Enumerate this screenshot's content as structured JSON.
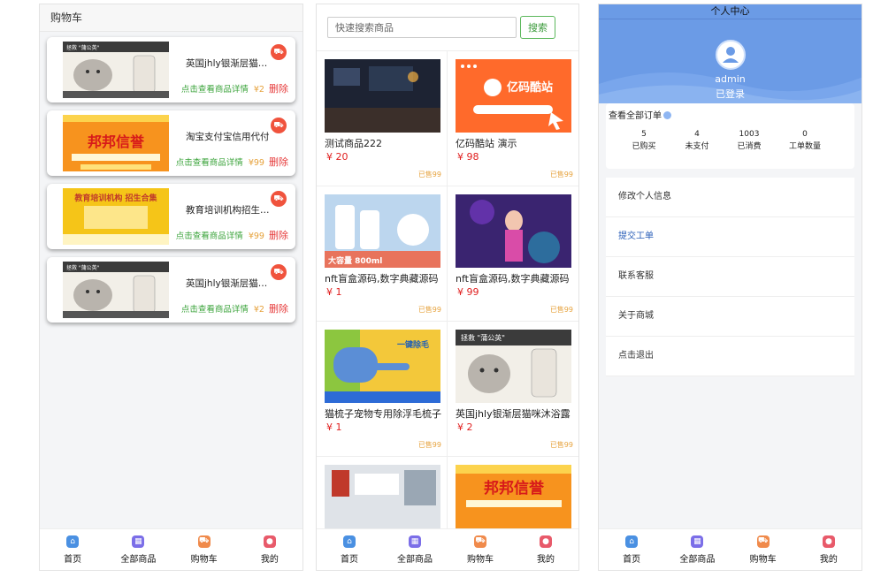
{
  "cart": {
    "title": "购物车",
    "items": [
      {
        "name": "英国jhly银渐层猫咪沐浴露",
        "detail": "点击查看商品详情",
        "price": "¥2",
        "delete": "删除",
        "image": "cat-shampoo",
        "img_text": "拯救 \"蒲公英\""
      },
      {
        "name": "淘宝支付宝信用代付",
        "detail": "点击查看商品详情",
        "price": "¥99",
        "delete": "删除",
        "image": "credit-banner",
        "img_text": "邦邦信誉"
      },
      {
        "name": "教育培训机构招生合集",
        "detail": "点击查看商品详情",
        "price": "¥99",
        "delete": "删除",
        "image": "edu-banner",
        "img_text": "教育培训机构 招生合集"
      },
      {
        "name": "英国jhly银渐层猫咪沐浴露",
        "detail": "点击查看商品详情",
        "price": "¥2",
        "delete": "删除",
        "image": "cat-shampoo",
        "img_text": "拯救 \"蒲公英\""
      }
    ]
  },
  "shop": {
    "search_placeholder": "快速搜索商品",
    "search_button": "搜索",
    "products": [
      {
        "name": "测试商品222",
        "price": "¥ 20",
        "sold": "已售99",
        "image": "dark-room"
      },
      {
        "name": "亿码酷站 演示",
        "price": "¥ 98",
        "sold": "已售99",
        "image": "yima-banner",
        "img_text": "亿码酷站"
      },
      {
        "name": "nft盲盒源码,数字典藏源码",
        "price": "¥ 1",
        "sold": "已售99",
        "image": "dog-shampoo",
        "img_text": "大容量 800ml"
      },
      {
        "name": "nft盲盒源码,数字典藏源码",
        "price": "¥ 99",
        "sold": "已售99",
        "image": "anime-girl"
      },
      {
        "name": "猫梳子宠物专用除浮毛梳子",
        "price": "¥ 1",
        "sold": "已售99",
        "image": "pet-comb",
        "img_text": "一键除毛"
      },
      {
        "name": "英国jhly银渐层猫咪沐浴露",
        "price": "¥ 2",
        "sold": "已售99",
        "image": "cat-shampoo",
        "img_text": "拯救 \"蒲公英\""
      },
      {
        "name": "",
        "price": "",
        "sold": "",
        "image": "shop-photo"
      },
      {
        "name": "",
        "price": "",
        "sold": "",
        "image": "credit-banner",
        "img_text": "邦邦信誉"
      }
    ]
  },
  "profile": {
    "title": "个人中心",
    "username": "admin",
    "login_status": "已登录",
    "orders_link": "查看全部订单",
    "stats": [
      {
        "value": "5",
        "label": "已购买"
      },
      {
        "value": "4",
        "label": "未支付"
      },
      {
        "value": "1003",
        "label": "已消费"
      },
      {
        "value": "0",
        "label": "工单数量"
      }
    ],
    "menu": [
      "修改个人信息",
      "提交工单",
      "联系客服",
      "关于商城",
      "点击退出"
    ]
  },
  "tabbar": [
    {
      "label": "首页",
      "icon": "home-icon",
      "color": "#4a90e2"
    },
    {
      "label": "全部商品",
      "icon": "products-icon",
      "color": "#7b6ee8"
    },
    {
      "label": "购物车",
      "icon": "cart-icon",
      "color": "#f08a4b"
    },
    {
      "label": "我的",
      "icon": "user-icon",
      "color": "#e85a6a"
    }
  ],
  "colors": {
    "accent_blue": "#6b9be6",
    "price_red": "#e02020",
    "sold_orange": "#e6a23c",
    "detail_green": "#3aa33a"
  }
}
